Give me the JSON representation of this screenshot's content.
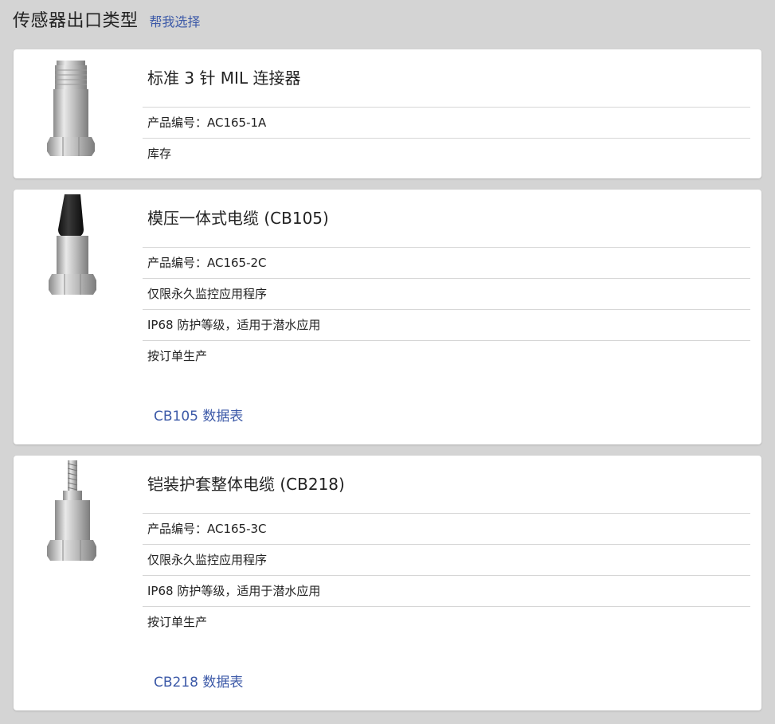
{
  "header": {
    "title": "传感器出口类型",
    "help_link": "帮我选择"
  },
  "products": [
    {
      "name": "标准 3 针 MIL 连接器",
      "features": [
        "产品编号：AC165-1A",
        "库存"
      ],
      "datasheet": ""
    },
    {
      "name": "模压一体式电缆 (CB105)",
      "features": [
        "产品编号：AC165-2C",
        "仅限永久监控应用程序",
        "IP68 防护等级，适用于潜水应用",
        "按订单生产"
      ],
      "datasheet": "CB105 数据表"
    },
    {
      "name": "铠装护套整体电缆 (CB218)",
      "features": [
        "产品编号：AC165-3C",
        "仅限永久监控应用程序",
        "IP68 防护等级，适用于潜水应用",
        "按订单生产"
      ],
      "datasheet": "CB218 数据表"
    }
  ]
}
